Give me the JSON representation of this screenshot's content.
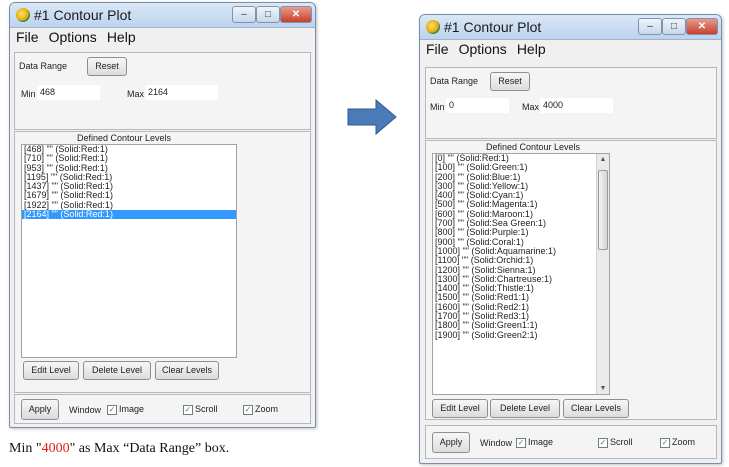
{
  "left_window": {
    "title": "#1 Contour Plot",
    "menu": [
      "File",
      "Options",
      "Help"
    ],
    "data_range_label": "Data Range",
    "reset_label": "Reset",
    "min_label": "Min",
    "min_value": "468",
    "max_label": "Max",
    "max_value": "2164",
    "levels_heading": "Defined Contour Levels",
    "levels": [
      "[468] \"\" (Solid:Red:1)",
      "[710] \"\" (Solid:Red:1)",
      "[953] \"\" (Solid:Red:1)",
      "[1195] \"\" (Solid:Red:1)",
      "[1437] \"\" (Solid:Red:1)",
      "[1679] \"\" (Solid:Red:1)",
      "[1922] \"\" (Solid:Red:1)",
      "[2164] \"\" (Solid:Red:1)"
    ],
    "selected_index": 7,
    "edit_level": "Edit Level",
    "delete_level": "Delete Level",
    "clear_levels": "Clear Levels",
    "apply": "Apply",
    "window_label": "Window",
    "image_label": "Image",
    "scroll_label": "Scroll",
    "zoom_label": "Zoom"
  },
  "right_window": {
    "title": "#1 Contour Plot",
    "menu": [
      "File",
      "Options",
      "Help"
    ],
    "data_range_label": "Data Range",
    "reset_label": "Reset",
    "min_label": "Min",
    "min_value": "0",
    "max_label": "Max",
    "max_value": "4000",
    "levels_heading": "Defined Contour Levels",
    "levels": [
      "[0] \"\" (Solid:Red:1)",
      "[100] \"\" (Solid:Green:1)",
      "[200] \"\" (Solid:Blue:1)",
      "[300] \"\" (Solid:Yellow:1)",
      "[400] \"\" (Solid:Cyan:1)",
      "[500] \"\" (Solid:Magenta:1)",
      "[600] \"\" (Solid:Maroon:1)",
      "[700] \"\" (Solid:Sea Green:1)",
      "[800] \"\" (Solid:Purple:1)",
      "[900] \"\" (Solid:Coral:1)",
      "[1000] \"\" (Solid:Aquamarine:1)",
      "[1100] \"\" (Solid:Orchid:1)",
      "[1200] \"\" (Solid:Sienna:1)",
      "[1300] \"\" (Solid:Chartreuse:1)",
      "[1400] \"\" (Solid:Thistle:1)",
      "[1500] \"\" (Solid:Red1:1)",
      "[1600] \"\" (Solid:Red2:1)",
      "[1700] \"\" (Solid:Red3:1)",
      "[1800] \"\" (Solid:Green1:1)",
      "[1900] \"\" (Solid:Green2:1)"
    ],
    "edit_level": "Edit Level",
    "delete_level": "Delete Level",
    "clear_levels": "Clear Levels",
    "apply": "Apply",
    "window_label": "Window",
    "image_label": "Image",
    "scroll_label": "Scroll",
    "zoom_label": "Zoom"
  },
  "caption": {
    "prefix": "Min \"",
    "value": "4000",
    "suffix": "\" as Max “Data Range” box."
  },
  "colors": {
    "arrow": "#4a7ab8",
    "selection": "#3399ff",
    "caption_value": "#e02020"
  }
}
